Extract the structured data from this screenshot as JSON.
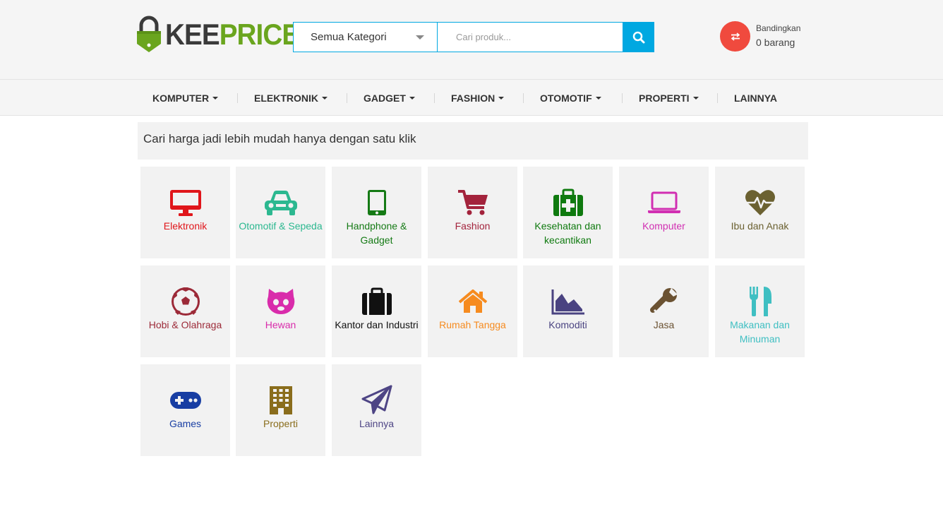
{
  "logo": {
    "part1": "KEE",
    "part2": "PRICE"
  },
  "search": {
    "category": "Semua Kategori",
    "placeholder": "Cari produk..."
  },
  "compare": {
    "label": "Bandingkan",
    "count": "0 barang"
  },
  "nav": [
    {
      "label": "KOMPUTER",
      "dropdown": true
    },
    {
      "label": "ELEKTRONIK",
      "dropdown": true
    },
    {
      "label": "GADGET",
      "dropdown": true
    },
    {
      "label": "FASHION",
      "dropdown": true
    },
    {
      "label": "OTOMOTIF",
      "dropdown": true
    },
    {
      "label": "PROPERTI",
      "dropdown": true
    },
    {
      "label": "LAINNYA",
      "dropdown": false
    }
  ],
  "tagline": "Cari harga jadi lebih mudah hanya dengan satu klik",
  "categories": [
    {
      "label": "Elektronik",
      "color": "#e0161b",
      "icon": "monitor-icon"
    },
    {
      "label": "Otomotif & Sepeda",
      "color": "#2cb890",
      "icon": "car-icon"
    },
    {
      "label": "Handphone & Gadget",
      "color": "#157a15",
      "icon": "tablet-icon"
    },
    {
      "label": "Fashion",
      "color": "#a3233c",
      "icon": "shopping-cart-icon"
    },
    {
      "label": "Kesehatan dan kecantikan",
      "color": "#0f7a0f",
      "icon": "medkit-icon"
    },
    {
      "label": "Komputer",
      "color": "#d12fb2",
      "icon": "laptop-icon"
    },
    {
      "label": "Ibu dan Anak",
      "color": "#6b6131",
      "icon": "heartbeat-icon"
    },
    {
      "label": "Hobi & Olahraga",
      "color": "#9c2a38",
      "icon": "soccer-ball-icon"
    },
    {
      "label": "Hewan",
      "color": "#d92cab",
      "icon": "cat-icon"
    },
    {
      "label": "Kantor dan Industri",
      "color": "#111111",
      "icon": "briefcase-icon"
    },
    {
      "label": "Rumah Tangga",
      "color": "#f68b1f",
      "icon": "home-icon"
    },
    {
      "label": "Komoditi",
      "color": "#4a4381",
      "icon": "area-chart-icon"
    },
    {
      "label": "Jasa",
      "color": "#6b5232",
      "icon": "wrench-icon"
    },
    {
      "label": "Makanan dan Minuman",
      "color": "#3fbfc2",
      "icon": "cutlery-icon"
    },
    {
      "label": "Games",
      "color": "#183ea3",
      "icon": "gamepad-icon"
    },
    {
      "label": "Properti",
      "color": "#8a6d1c",
      "icon": "building-icon"
    },
    {
      "label": "Lainnya",
      "color": "#4e4585",
      "icon": "paper-plane-icon"
    }
  ]
}
